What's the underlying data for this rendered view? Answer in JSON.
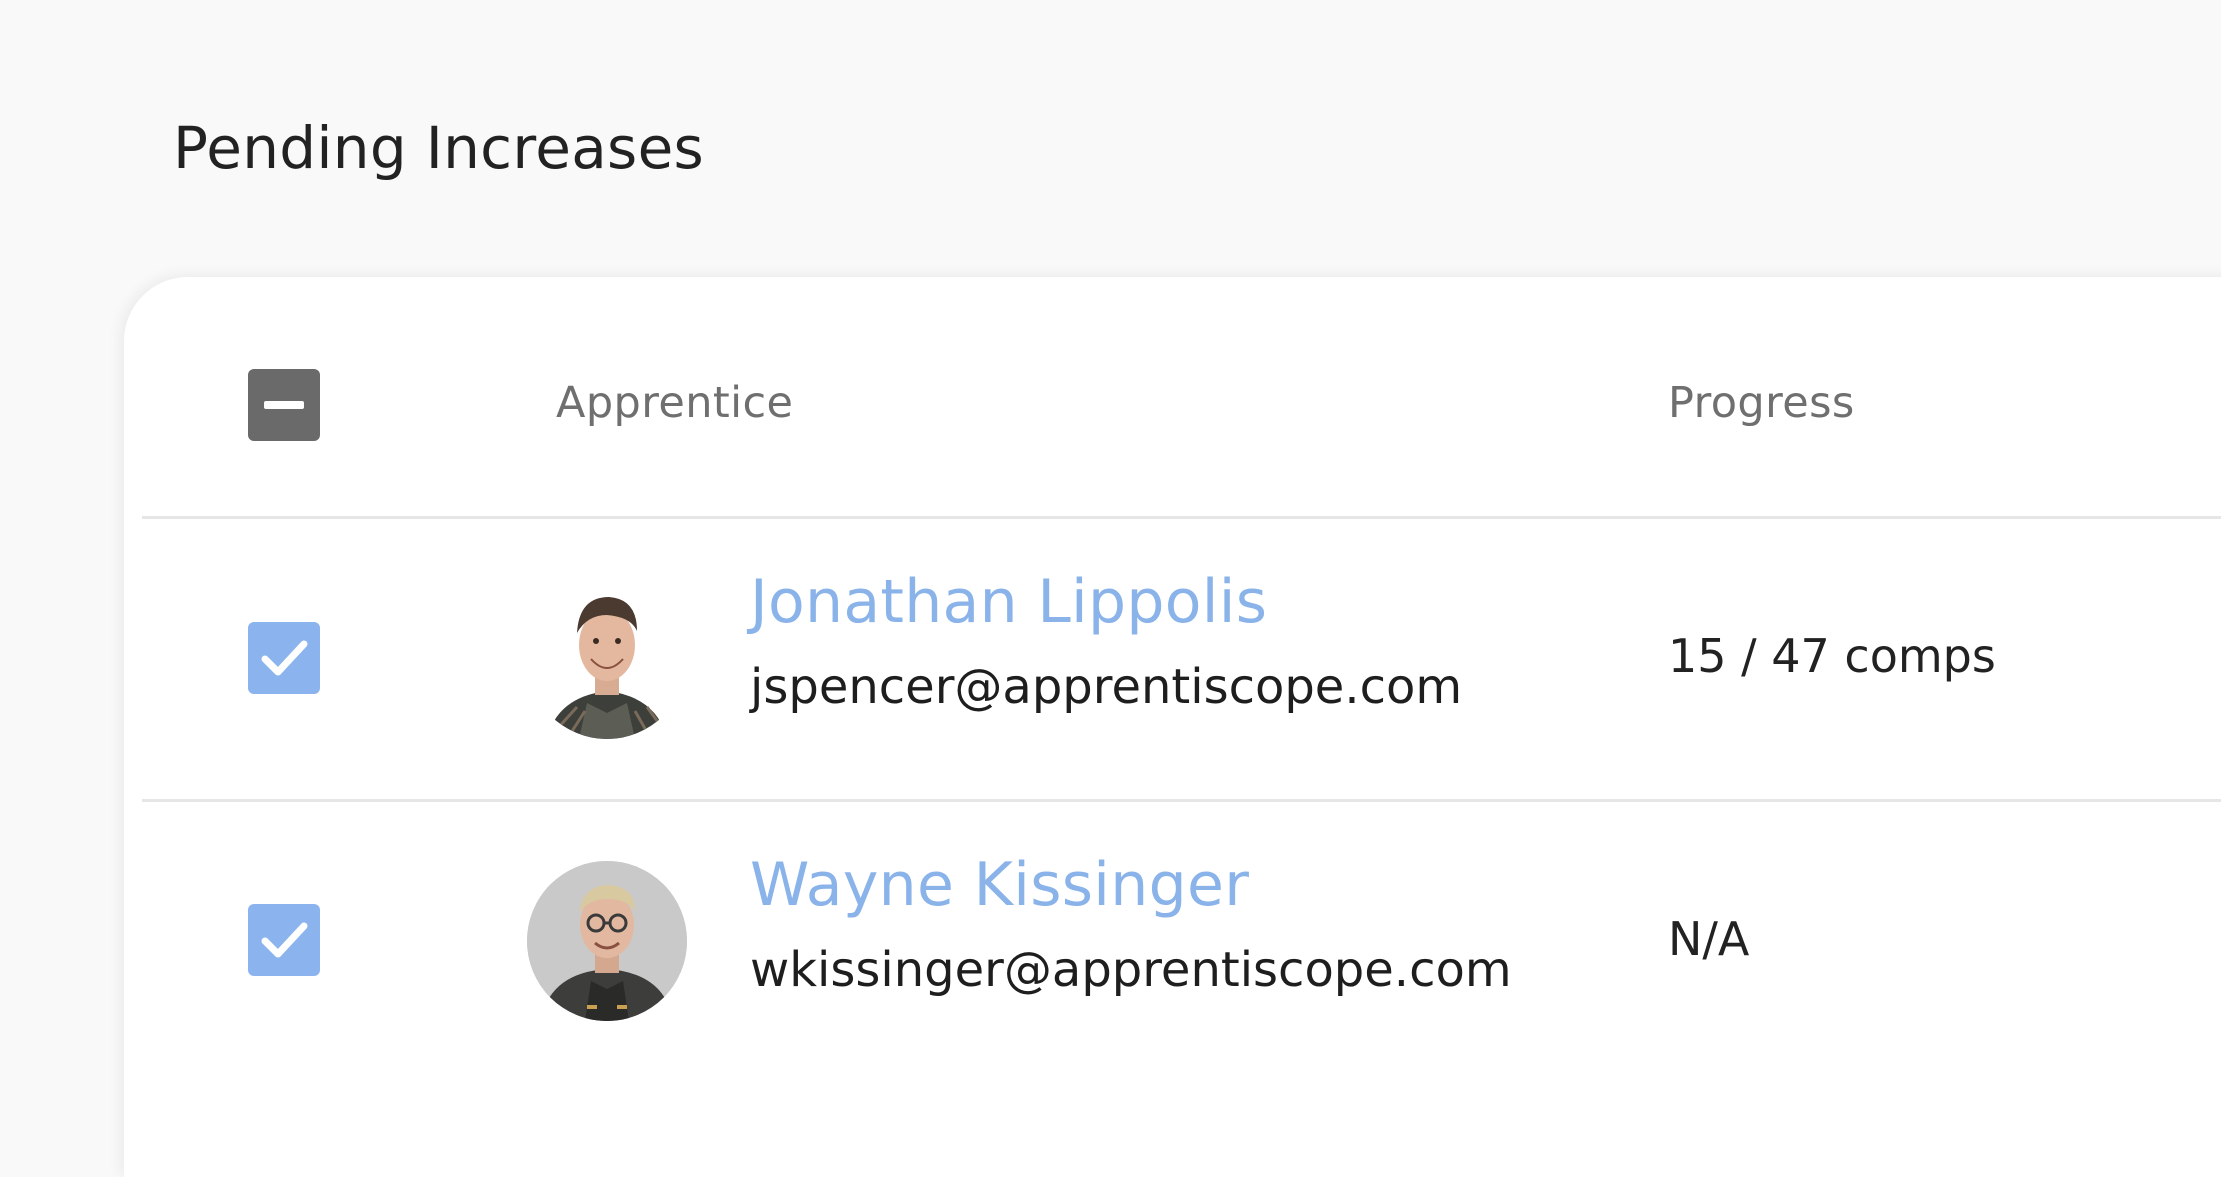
{
  "page": {
    "title": "Pending Increases"
  },
  "table": {
    "columns": {
      "apprentice": "Apprentice",
      "progress": "Progress"
    },
    "select_all_state": "indeterminate",
    "rows": [
      {
        "selected": true,
        "avatar": "photo-jonathan-lippolis",
        "name": "Jonathan Lippolis",
        "email": "jspencer@apprentiscope.com",
        "progress": "15 / 47 comps"
      },
      {
        "selected": true,
        "avatar": "photo-wayne-kissinger",
        "name": "Wayne Kissinger",
        "email": "wkissinger@apprentiscope.com",
        "progress": "N/A"
      }
    ]
  },
  "colors": {
    "background": "#f9f9f9",
    "card": "#ffffff",
    "name_link": "#8ab3ea",
    "checkbox_checked": "#8bb4ee",
    "checkbox_indeterminate": "#6a6a6a",
    "divider": "#e6e6e6"
  }
}
